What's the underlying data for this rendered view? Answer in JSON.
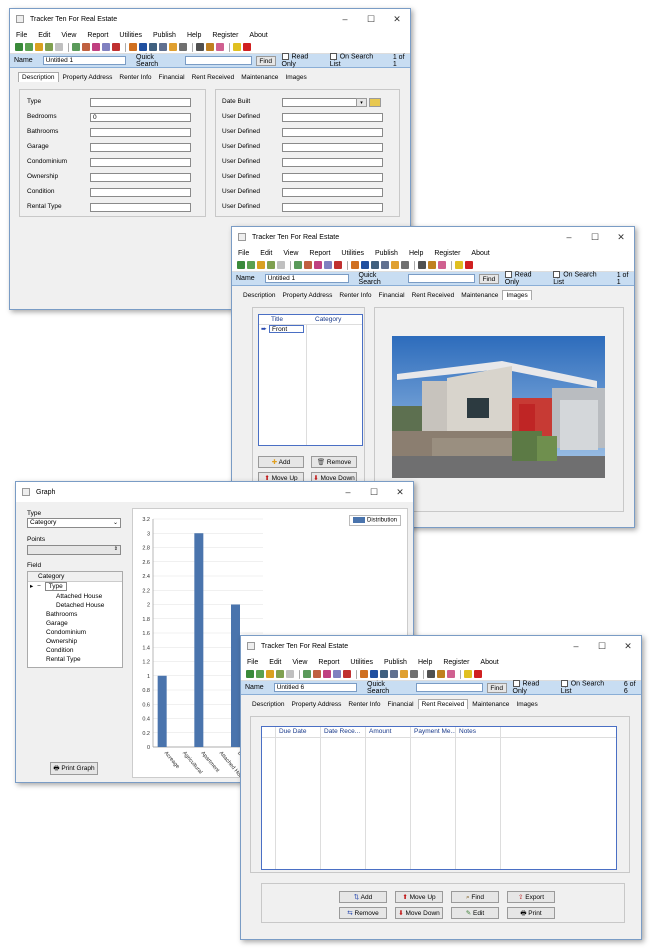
{
  "app": {
    "title": "Tracker Ten For Real Estate",
    "menu": [
      "File",
      "Edit",
      "View",
      "Report",
      "Utilities",
      "Publish",
      "Help",
      "Register",
      "About"
    ],
    "name_label": "Name",
    "quick_search_label": "Quick Search",
    "find_label": "Find",
    "read_only_label": "Read Only",
    "on_search_list_label": "On Search List"
  },
  "window1": {
    "name_value": "Untitled 1",
    "record_count": "1 of 1",
    "tabs": [
      "Description",
      "Property Address",
      "Renter Info",
      "Financial",
      "Rent Received",
      "Maintenance",
      "Images"
    ],
    "left_fields": [
      {
        "label": "Type",
        "value": ""
      },
      {
        "label": "Bedrooms",
        "value": "0"
      },
      {
        "label": "Bathrooms",
        "value": ""
      },
      {
        "label": "Garage",
        "value": ""
      },
      {
        "label": "Condominium",
        "value": ""
      },
      {
        "label": "Ownership",
        "value": ""
      },
      {
        "label": "Condition",
        "value": ""
      },
      {
        "label": "Rental Type",
        "value": ""
      }
    ],
    "right_fields": [
      {
        "label": "Date Built",
        "value": ""
      },
      {
        "label": "User Defined",
        "value": ""
      },
      {
        "label": "User Defined",
        "value": ""
      },
      {
        "label": "User Defined",
        "value": ""
      },
      {
        "label": "User Defined",
        "value": ""
      },
      {
        "label": "User Defined",
        "value": ""
      },
      {
        "label": "User Defined",
        "value": ""
      },
      {
        "label": "User Defined",
        "value": ""
      }
    ]
  },
  "window2": {
    "name_value": "Untitled 1",
    "record_count": "1 of 1",
    "tabs": [
      "Description",
      "Property Address",
      "Renter Info",
      "Financial",
      "Rent Received",
      "Maintenance",
      "Images"
    ],
    "col_title": "Title",
    "col_category": "Category",
    "row_title": "Front",
    "buttons": {
      "add": "Add",
      "remove": "Remove",
      "move_up": "Move Up",
      "move_down": "Move Down"
    }
  },
  "graph": {
    "title": "Graph",
    "type_label": "Type",
    "type_value": "Category",
    "points_label": "Points",
    "field_label": "Field",
    "tree_header": "Category",
    "tree_items": [
      "Type",
      "Attached House",
      "Detached House",
      "Bathrooms",
      "Garage",
      "Condominium",
      "Ownership",
      "Condition",
      "Rental Type"
    ],
    "print_button": "Print Graph",
    "legend": "Distribution"
  },
  "chart_data": {
    "type": "bar",
    "categories": [
      "Acreage",
      "Agricultural",
      "Apartment",
      "Attached House",
      "Detached House",
      "Mobile"
    ],
    "values": [
      1,
      0,
      3,
      0,
      2,
      0
    ],
    "series": [
      {
        "name": "Distribution",
        "values": [
          1,
          0,
          3,
          0,
          2,
          0
        ]
      }
    ],
    "ylim": [
      0,
      3.2
    ],
    "yticks": [
      "0",
      "0.2",
      "0.4",
      "0.6",
      "0.8",
      "1",
      "1.2",
      "1.4",
      "1.6",
      "1.8",
      "2",
      "2.2",
      "2.4",
      "2.6",
      "2.8",
      "3",
      "3.2"
    ],
    "tick_labels": [
      "Acreage",
      "Agricultural",
      "Apartment",
      "Attached House",
      "Detached Hous",
      "Mobile"
    ],
    "grid": true,
    "legend_position": "top-right",
    "bar_color": "#4a74ad"
  },
  "window4": {
    "name_value": "Untitled 6",
    "record_count": "6 of 6",
    "tabs": [
      "Description",
      "Property Address",
      "Renter Info",
      "Financial",
      "Rent Received",
      "Maintenance",
      "Images"
    ],
    "columns": [
      "Due Date",
      "Date Rece...",
      "Amount",
      "Payment Me...",
      "Notes"
    ],
    "buttons": {
      "add": "Add",
      "remove": "Remove",
      "move_up": "Move Up",
      "move_down": "Move Down",
      "find": "Find",
      "edit": "Edit",
      "export": "Export",
      "print": "Print"
    }
  }
}
